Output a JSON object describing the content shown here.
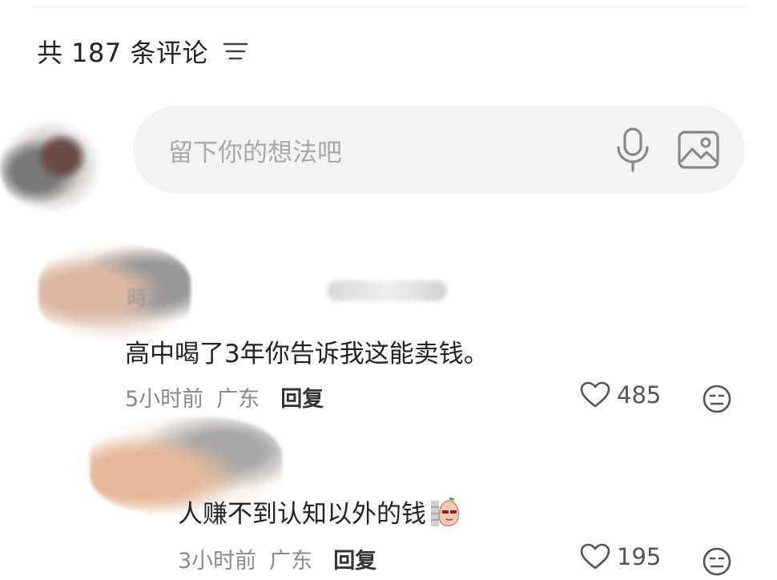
{
  "header": {
    "title": "共 187 条评论",
    "sort_icon": "sort-lines-icon"
  },
  "composer": {
    "placeholder": "留下你的想法吧",
    "voice_icon": "microphone-icon",
    "image_icon": "image-icon"
  },
  "comments": [
    {
      "username": "時濟",
      "text": "高中喝了3年你告诉我这能卖钱。",
      "time": "5小时前",
      "region": "广东",
      "reply_label": "回复",
      "likes": "485"
    },
    {
      "text": "人赚不到认知以外的钱",
      "sticker": "peach-sticker-icon",
      "time": "3小时前",
      "region": "广东",
      "reply_label": "回复",
      "likes": "195"
    }
  ]
}
